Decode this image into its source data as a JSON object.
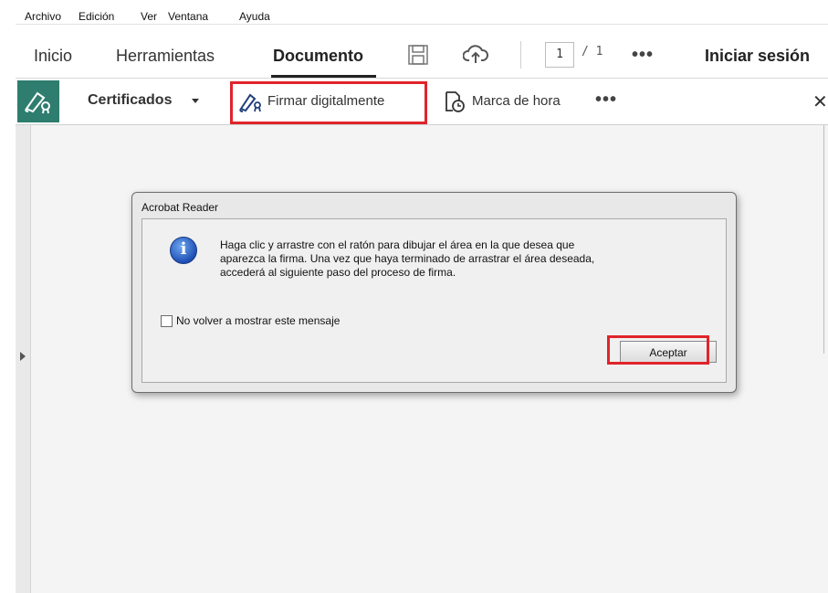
{
  "menu": [
    "Archivo",
    "Edición",
    "Ver",
    "Ventana",
    "Ayuda"
  ],
  "tabs": {
    "inicio": "Inicio",
    "herramientas": "Herramientas",
    "documento": "Documento",
    "signin": "Iniciar sesión"
  },
  "pager": {
    "current": "1",
    "total": "/ 1"
  },
  "more": "•••",
  "toolbar": {
    "certificados": "Certificados",
    "firmar": "Firmar digitalmente",
    "marca": "Marca de hora",
    "more": "•••",
    "close": "✕"
  },
  "dialog": {
    "title": "Acrobat Reader",
    "message_line1": "Haga clic y arrastre con el ratón para dibujar el área en la que desea que",
    "message_line2": "aparezca la firma. Una vez que haya terminado de arrastrar el área deseada,",
    "message_line3": "accederá al siguiente paso del proceso de firma.",
    "checkbox_label": "No volver a mostrar este mensaje",
    "ok_label": "Aceptar"
  },
  "colors": {
    "accent": "#2e7d6e",
    "highlight": "#e0242b",
    "info": "#1e4fb6"
  },
  "icons": [
    "pen-signature-icon",
    "save-icon",
    "cloud-upload-icon",
    "timestamp-icon",
    "info-icon",
    "close-icon",
    "expand-arrow-icon"
  ]
}
